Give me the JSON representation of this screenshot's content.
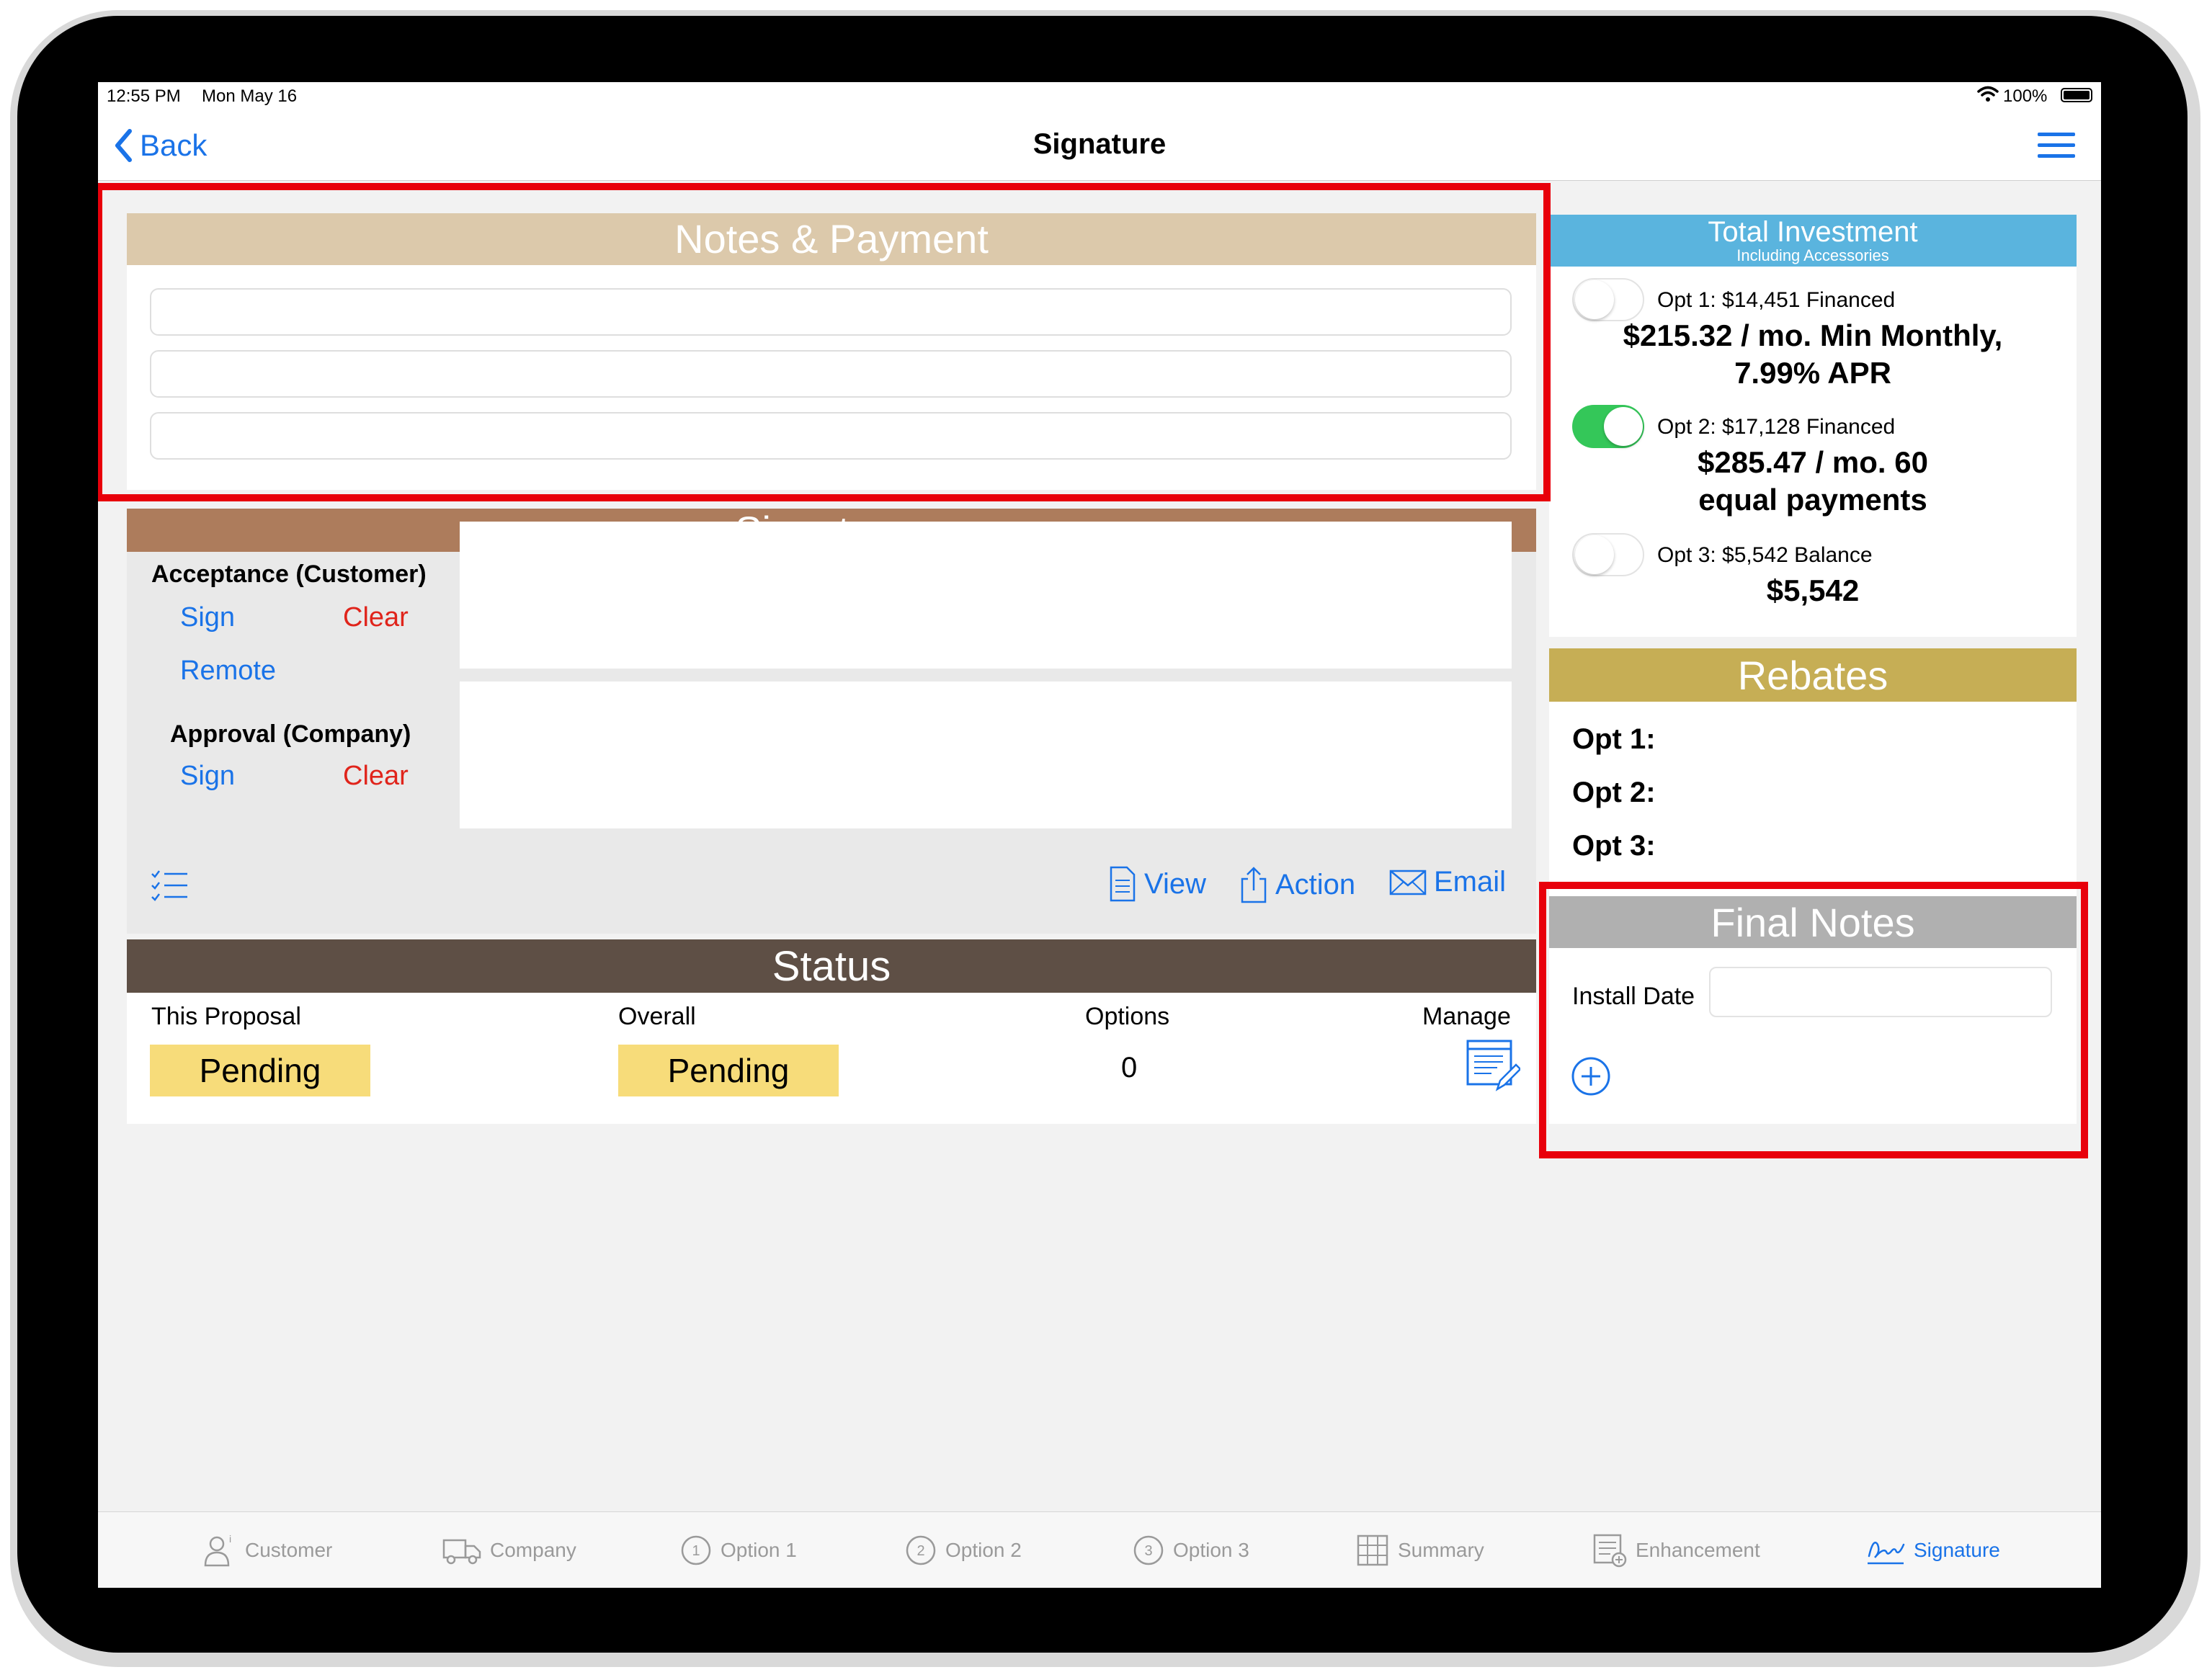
{
  "status_bar": {
    "time": "12:55 PM",
    "date": "Mon May 16",
    "battery": "100%"
  },
  "nav": {
    "back_label": "Back",
    "title": "Signature"
  },
  "notes_payment": {
    "title": "Notes & Payment",
    "fields": [
      "",
      "",
      ""
    ]
  },
  "signatures": {
    "title": "Signatures",
    "acceptance_label": "Acceptance (Customer)",
    "approval_label": "Approval (Company)",
    "sign_label": "Sign",
    "clear_label": "Clear",
    "remote_label": "Remote",
    "view_label": "View",
    "action_label": "Action",
    "email_label": "Email"
  },
  "status": {
    "title": "Status",
    "this_proposal_label": "This Proposal",
    "overall_label": "Overall",
    "options_label": "Options",
    "manage_label": "Manage",
    "this_proposal_value": "Pending",
    "overall_value": "Pending",
    "options_count": "0"
  },
  "total_investment": {
    "title": "Total Investment",
    "subtitle": "Including Accessories",
    "options": [
      {
        "label": "Opt 1: $14,451 Financed",
        "amount_line1": "$215.32  / mo. Min Monthly,",
        "amount_line2": "7.99% APR",
        "enabled": false
      },
      {
        "label": "Opt 2: $17,128 Financed",
        "amount_line1": "$285.47  / mo. 60",
        "amount_line2": "equal payments",
        "enabled": true
      },
      {
        "label": "Opt 3: $5,542 Balance",
        "amount_line1": "$5,542",
        "amount_line2": "",
        "enabled": false
      }
    ]
  },
  "rebates": {
    "title": "Rebates",
    "items": [
      "Opt 1:",
      "Opt 2:",
      "Opt 3:"
    ]
  },
  "final_notes": {
    "title": "Final Notes",
    "install_date_label": "Install Date",
    "install_date_value": ""
  },
  "tabs": [
    {
      "label": "Customer",
      "icon": "customer-icon",
      "active": false
    },
    {
      "label": "Company",
      "icon": "truck-icon",
      "active": false
    },
    {
      "label": "Option 1",
      "icon": "option-1-icon",
      "active": false
    },
    {
      "label": "Option 2",
      "icon": "option-2-icon",
      "active": false
    },
    {
      "label": "Option 3",
      "icon": "option-3-icon",
      "active": false
    },
    {
      "label": "Summary",
      "icon": "summary-icon",
      "active": false
    },
    {
      "label": "Enhancement",
      "icon": "enhancement-icon",
      "active": false
    },
    {
      "label": "Signature",
      "icon": "signature-icon",
      "active": true
    }
  ],
  "colors": {
    "accent": "#1a73e8",
    "clear_red": "#e0241b",
    "notes_header": "#dcc9ab",
    "signatures_header": "#ad7c5c",
    "status_header": "#5e4f45",
    "investment_header": "#5ab4de",
    "rebates_header": "#c6ae55",
    "final_notes_header": "#b0b0b0",
    "pending_pill": "#f7dc7a",
    "toggle_on": "#34c759",
    "highlight_red": "#e8000b"
  }
}
